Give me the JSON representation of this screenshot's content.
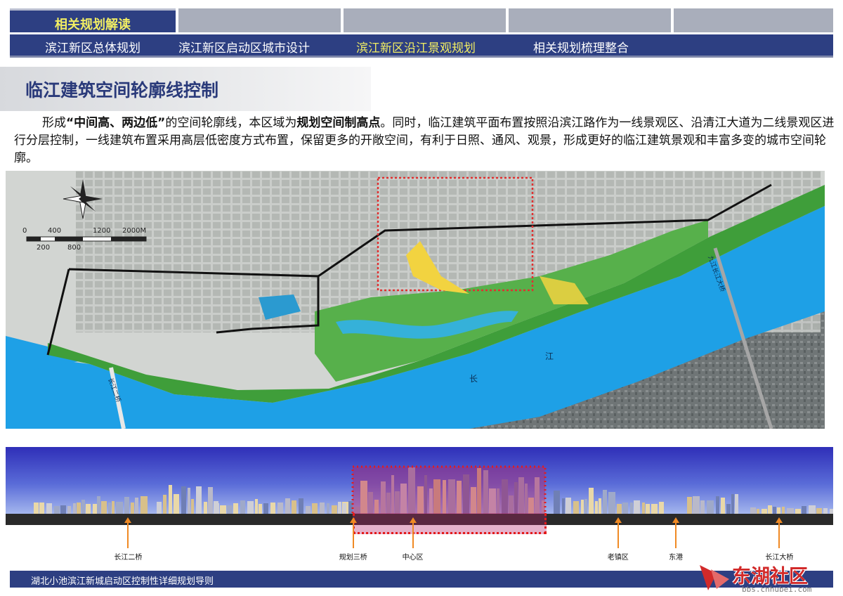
{
  "tabs": {
    "section_tab": "相关规划解读",
    "items": [
      {
        "label": "滨江新区总体规划",
        "active": false
      },
      {
        "label": "滨江新区启动区城市设计",
        "active": false
      },
      {
        "label": "滨江新区沿江景观规划",
        "active": true
      },
      {
        "label": "相关规划梳理整合",
        "active": false
      }
    ]
  },
  "section_title": "临江建筑空间轮廓线控制",
  "paragraph": {
    "t1": "形成",
    "b1": "“中间高、两边低”",
    "t2": "的空间轮廓线，本区域为",
    "b2": "规划空间制高点",
    "t3": "。同时，临江建筑平面布置按照沿滨江路作为一线景观区、沿清江大道为二线景观区进行分层控制，一线建筑布置采用高层低密度方式布置，保留更多的开敞空间，有利于日照、通风、观景，形成更好的临江建筑景观和丰富多变的城市空间轮廓。"
  },
  "map": {
    "scale_top": [
      "0",
      "400",
      "1200",
      "2000M"
    ],
    "scale_bottom": [
      "200",
      "800"
    ],
    "river_labels": [
      "长",
      "江"
    ],
    "bridge_labels": [
      "长江二桥",
      "九江长江大桥"
    ]
  },
  "skyline": {
    "markers": [
      {
        "label": "长江二桥",
        "pos": 0.148
      },
      {
        "label": "规划三桥",
        "pos": 0.42
      },
      {
        "label": "中心区",
        "pos": 0.492
      },
      {
        "label": "老镇区",
        "pos": 0.74
      },
      {
        "label": "东港",
        "pos": 0.81
      },
      {
        "label": "长江大桥",
        "pos": 0.935
      }
    ]
  },
  "footer": {
    "text": "湖北小池滨江新城启动区控制性详细规划导则"
  },
  "watermark": {
    "brand": "东湖社区",
    "url": "bbs.cnhubei.com"
  },
  "colors": {
    "navy": "#2d3f82",
    "tab_grey": "#a9aebb",
    "active_yellow": "#f2ee63",
    "title_blue": "#2a3a7a",
    "river": "#1ea0e6",
    "park_green": "#3f9e3a"
  }
}
